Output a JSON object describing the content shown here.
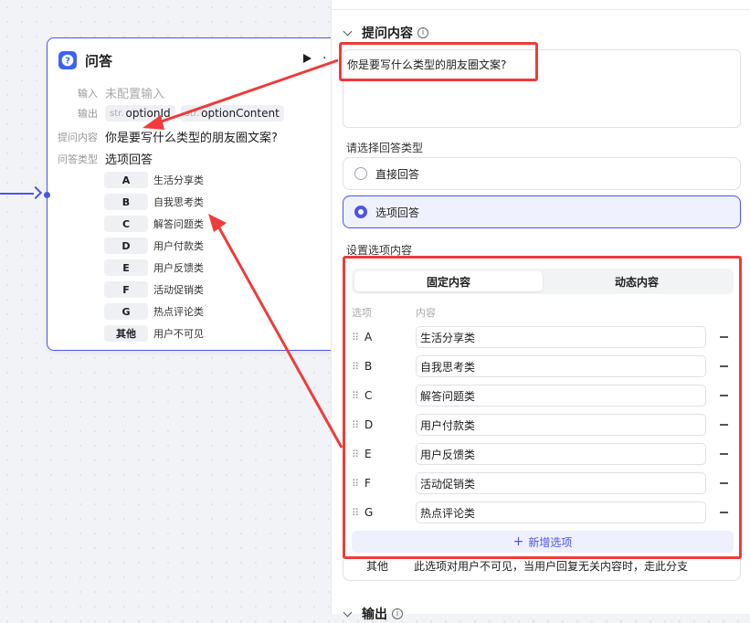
{
  "node": {
    "title": "问答",
    "input_label": "输入",
    "input_value": "未配置输入",
    "output_label": "输出",
    "outputs": [
      {
        "type": "str.",
        "name": "optionId"
      },
      {
        "type": "str.",
        "name": "optionContent"
      }
    ],
    "question_label": "提问内容",
    "question_value": "你是要写什么类型的朋友圈文案?",
    "answer_type_label": "问答类型",
    "answer_type_value": "选项回答",
    "options": [
      {
        "key": "A",
        "value": "生活分享类"
      },
      {
        "key": "B",
        "value": "自我思考类"
      },
      {
        "key": "C",
        "value": "解答问题类"
      },
      {
        "key": "D",
        "value": "用户付款类"
      },
      {
        "key": "E",
        "value": "用户反馈类"
      },
      {
        "key": "F",
        "value": "活动促销类"
      },
      {
        "key": "G",
        "value": "热点评论类"
      },
      {
        "key": "其他",
        "value": "用户不可见"
      }
    ]
  },
  "panel": {
    "question_section_title": "提问内容",
    "question_text": "你是要写什么类型的朋友圈文案?",
    "answer_type_label": "请选择回答类型",
    "answer_types": [
      "直接回答",
      "选项回答"
    ],
    "selected_answer_type": "选项回答",
    "options_label": "设置选项内容",
    "tabs": [
      "固定内容",
      "动态内容"
    ],
    "active_tab": "固定内容",
    "col_option": "选项",
    "col_content": "内容",
    "options": [
      {
        "key": "A",
        "value": "生活分享类"
      },
      {
        "key": "B",
        "value": "自我思考类"
      },
      {
        "key": "C",
        "value": "解答问题类"
      },
      {
        "key": "D",
        "value": "用户付款类"
      },
      {
        "key": "E",
        "value": "用户反馈类"
      },
      {
        "key": "F",
        "value": "活动促销类"
      },
      {
        "key": "G",
        "value": "热点评论类"
      }
    ],
    "add_option": "新增选项",
    "other_key": "其他",
    "other_text": "此选项对用户不可见，当用户回复无关内容时，走此分支",
    "output_section_title": "输出"
  },
  "colors": {
    "accent": "#4d53e8",
    "annotation_red": "#ef3b3b",
    "node_icon": "#3b63f0"
  }
}
